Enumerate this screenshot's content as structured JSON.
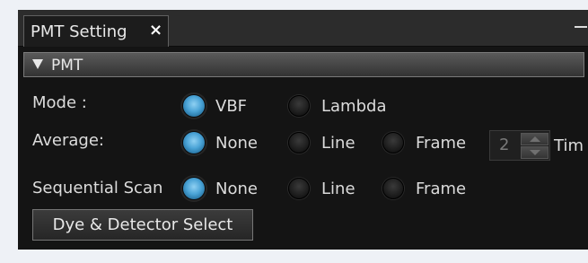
{
  "tab": {
    "title": "PMT Setting",
    "close_glyph": "×"
  },
  "section": {
    "title": "PMT"
  },
  "mode": {
    "label": "Mode :",
    "options": [
      {
        "label": "VBF",
        "checked": true
      },
      {
        "label": "Lambda",
        "checked": false
      }
    ]
  },
  "average": {
    "label": "Average:",
    "options": [
      {
        "label": "None",
        "checked": true
      },
      {
        "label": "Line",
        "checked": false
      },
      {
        "label": "Frame",
        "checked": false
      }
    ],
    "count": {
      "value": "2",
      "unit": "Tim"
    }
  },
  "sequential_scan": {
    "label": "Sequential Scan",
    "options": [
      {
        "label": "None",
        "checked": true
      },
      {
        "label": "Line",
        "checked": false
      },
      {
        "label": "Frame",
        "checked": false
      }
    ]
  },
  "dye_button": {
    "label": "Dye & Detector Select"
  },
  "colors": {
    "accent": "#4aa3d6",
    "background": "#141414",
    "text": "#dcdcdc"
  }
}
